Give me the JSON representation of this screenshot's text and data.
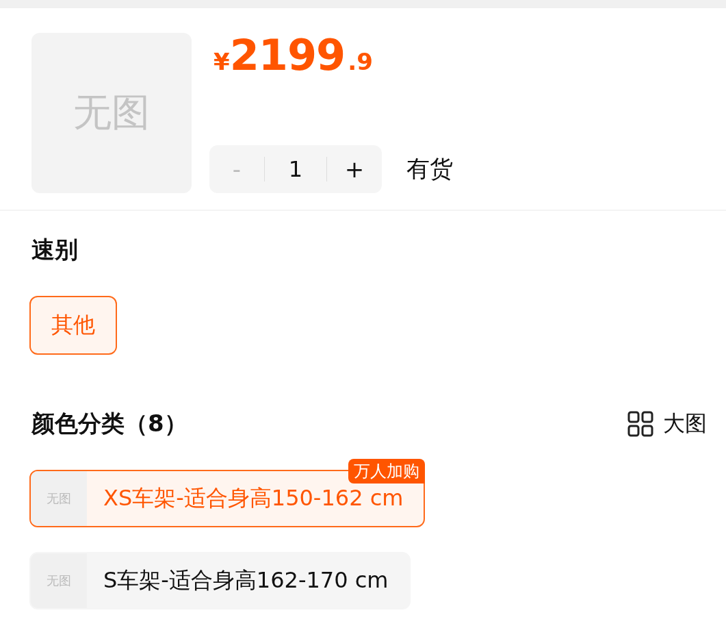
{
  "product": {
    "image_text": "无图",
    "price": {
      "currency": "¥",
      "integer": "2199",
      "decimal": ".9"
    },
    "quantity": {
      "minus": {
        "label": "-",
        "disabled": true
      },
      "value": "1",
      "plus": {
        "label": "+",
        "disabled": false
      }
    },
    "stock": "有货"
  },
  "sections": [
    {
      "title": "速别",
      "kind": "chips",
      "options": [
        {
          "label": "其他",
          "selected": true
        }
      ]
    },
    {
      "title": "颜色分类（8）",
      "kind": "rows",
      "view_toggle": "大图",
      "options": [
        {
          "thumb_text": "无图",
          "label": "XS车架-适合身高150-162 cm",
          "selected": true,
          "badge": "万人加购"
        },
        {
          "thumb_text": "无图",
          "label": "S车架-适合身高162-170 cm",
          "selected": false
        }
      ]
    }
  ]
}
